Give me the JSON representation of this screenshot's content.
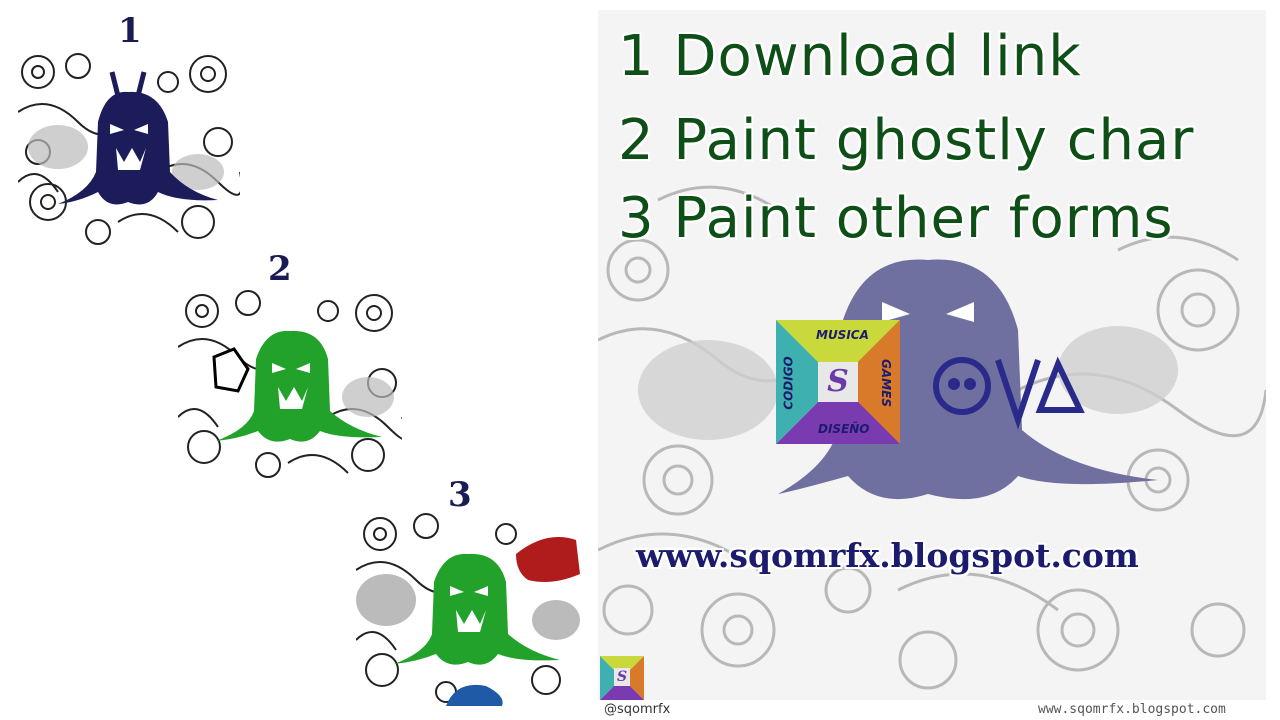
{
  "steps": [
    {
      "number": "1",
      "ghost_color": "#1c1c5a",
      "description": "navy ghost on doodle background"
    },
    {
      "number": "2",
      "ghost_color": "#22a22a",
      "description": "green ghost on doodle background"
    },
    {
      "number": "3",
      "ghost_color": "#22a22a",
      "accent_colors": [
        "#b01c1c",
        "#1e5aa6"
      ]
    }
  ],
  "heading": {
    "line1": "1 Download link",
    "line2": "2 Paint ghostly char",
    "line3": "3 Paint other forms"
  },
  "main_ghost_color": "#6f6fa0",
  "logo": {
    "top": "MUSICA",
    "left": "CODIGO",
    "right": "GAMES",
    "bottom": "DISEÑO",
    "center": "S",
    "colors": [
      "#c9d83a",
      "#3fb0b0",
      "#7a3ab0",
      "#d97a2a"
    ]
  },
  "site_url": "www.sqomrfx.blogspot.com",
  "footer": {
    "handle": "@sqomrfx",
    "url": "www.sqomrfx.blogspot.com",
    "mini_logo_letter": "S"
  },
  "colors": {
    "heading": "#0d4f16",
    "url": "#1c1c6e",
    "step_number": "#1a1a55"
  }
}
